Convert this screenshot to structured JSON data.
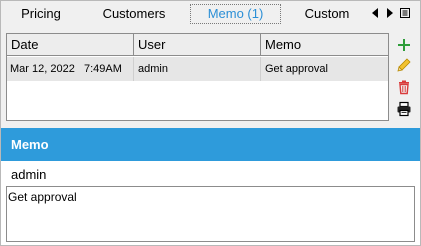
{
  "tabs": [
    {
      "label": "Pricing"
    },
    {
      "label": "Customers"
    },
    {
      "label": "Memo (1)",
      "selected": true
    },
    {
      "label": "Custom"
    }
  ],
  "tab_nav": {
    "left_icon": "triangle-left-icon",
    "right_icon": "triangle-right-icon",
    "list_icon": "tab-list-icon"
  },
  "table": {
    "columns": [
      "Date",
      "User",
      "Memo"
    ],
    "rows": [
      {
        "date": "Mar 12, 2022   7:49AM",
        "user": "admin",
        "memo": "Get approval"
      }
    ]
  },
  "actions": {
    "add_icon": "plus-icon",
    "edit_icon": "pencil-icon",
    "delete_icon": "trash-icon",
    "print_icon": "printer-icon"
  },
  "memo": {
    "title": "Memo",
    "user": "admin",
    "text": "Get approval"
  },
  "colors": {
    "accent": "#2e9bdb",
    "selected_tab_text": "#2b8fd6",
    "add_icon": "#2e9d3a",
    "edit_icon": "#d9a400",
    "delete_icon": "#d93a3a"
  }
}
